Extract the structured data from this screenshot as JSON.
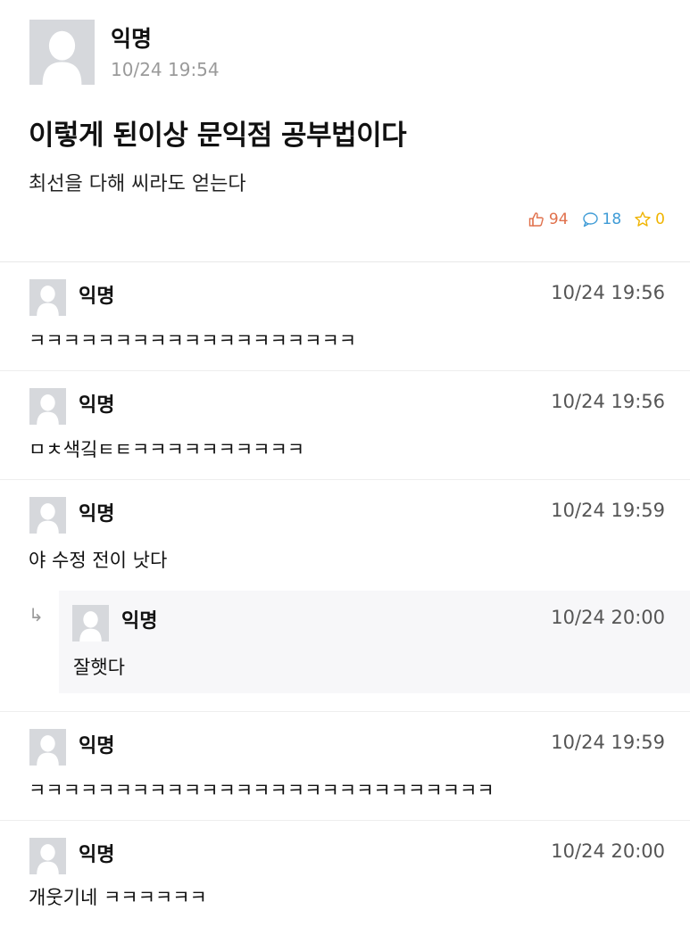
{
  "post": {
    "author": "익명",
    "time": "10/24 19:54",
    "title": "이렇게 된이상 문익점 공부법이다",
    "body": "최선을 다해 씨라도 얻는다",
    "likes": "94",
    "comments": "18",
    "scraps": "0",
    "icons": {
      "like": "thumbs-up-icon",
      "comment": "speech-bubble-icon",
      "scrap": "star-icon"
    },
    "colors": {
      "like": "#e0704b",
      "comment": "#3e9bd6",
      "scrap": "#f0b400"
    }
  },
  "comments": [
    {
      "author": "익명",
      "time": "10/24 19:56",
      "text": "ㅋㅋㅋㅋㅋㅋㅋㅋㅋㅋㅋㅋㅋㅋㅋㅋㅋㅋㅋ"
    },
    {
      "author": "익명",
      "time": "10/24 19:56",
      "text": "ㅁㅊ색깈ㅌㅌㅋㅋㅋㅋㅋㅋㅋㅋㅋㅋ"
    },
    {
      "author": "익명",
      "time": "10/24 19:59",
      "text": "야 수정 전이 낫다",
      "reply": {
        "arrow": "↳",
        "author": "익명",
        "time": "10/24 20:00",
        "text": "잘햇다"
      }
    },
    {
      "author": "익명",
      "time": "10/24 19:59",
      "text": "ㅋㅋㅋㅋㅋㅋㅋㅋㅋㅋㅋㅋㅋㅋㅋㅋㅋㅋㅋㅋㅋㅋㅋㅋㅋㅋㅋ"
    },
    {
      "author": "익명",
      "time": "10/24 20:00",
      "text": "개웃기네 ㅋㅋㅋㅋㅋㅋ"
    }
  ]
}
